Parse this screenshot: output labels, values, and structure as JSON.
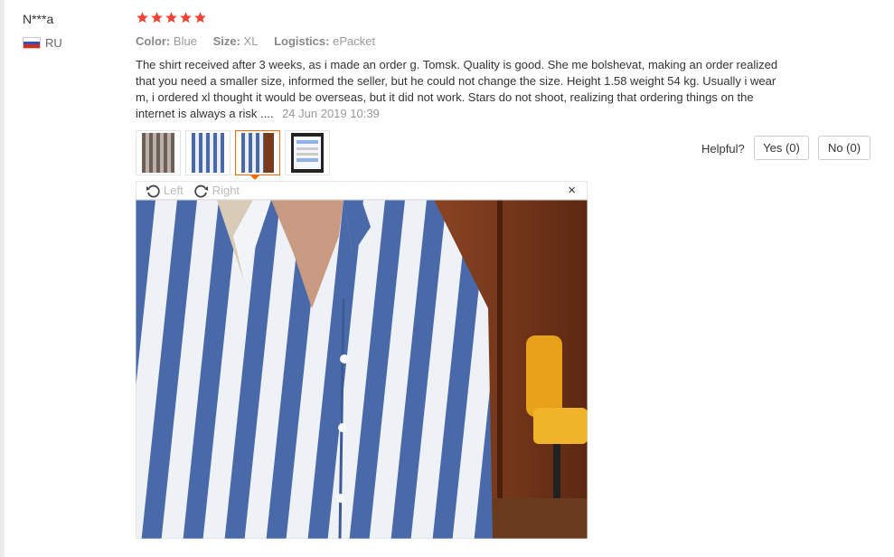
{
  "reviewer": {
    "name": "N***a",
    "country": "RU"
  },
  "rating": {
    "stars": 5,
    "max": 5,
    "color": "#f44336"
  },
  "attributes": [
    {
      "key": "Color:",
      "value": "Blue"
    },
    {
      "key": "Size:",
      "value": "XL"
    },
    {
      "key": "Logistics:",
      "value": "ePacket"
    }
  ],
  "review": {
    "text": "The shirt received after 3 weeks, as i made an order g. Tomsk. Quality is good. She me bolshevat, making an order realized that you need a smaller size, informed the seller, but he could not change the size. Height 1.58 weight 54 kg. Usually i wear m, i ordered xl thought it would be overseas, but it did not work. Stars do not shoot, realizing that ordering things on the internet is always a risk ....",
    "date": "24 Jun 2019 10:39"
  },
  "helpful": {
    "label": "Helpful?",
    "yes_label": "Yes (0)",
    "no_label": "No (0)"
  },
  "viewer": {
    "rotate_left_label": "Left",
    "rotate_right_label": "Right",
    "close_symbol": "×"
  },
  "colors": {
    "accent": "#ff6600",
    "stripe_blue": "#4a69a8",
    "wall_brown": "#7a3a1c"
  },
  "thumbnails": [
    {
      "icon": "photo-shirt-icon",
      "active": false
    },
    {
      "icon": "photo-shirt-icon",
      "active": false
    },
    {
      "icon": "photo-shirt-icon",
      "active": true
    },
    {
      "icon": "chat-screenshot-icon",
      "active": false
    }
  ]
}
